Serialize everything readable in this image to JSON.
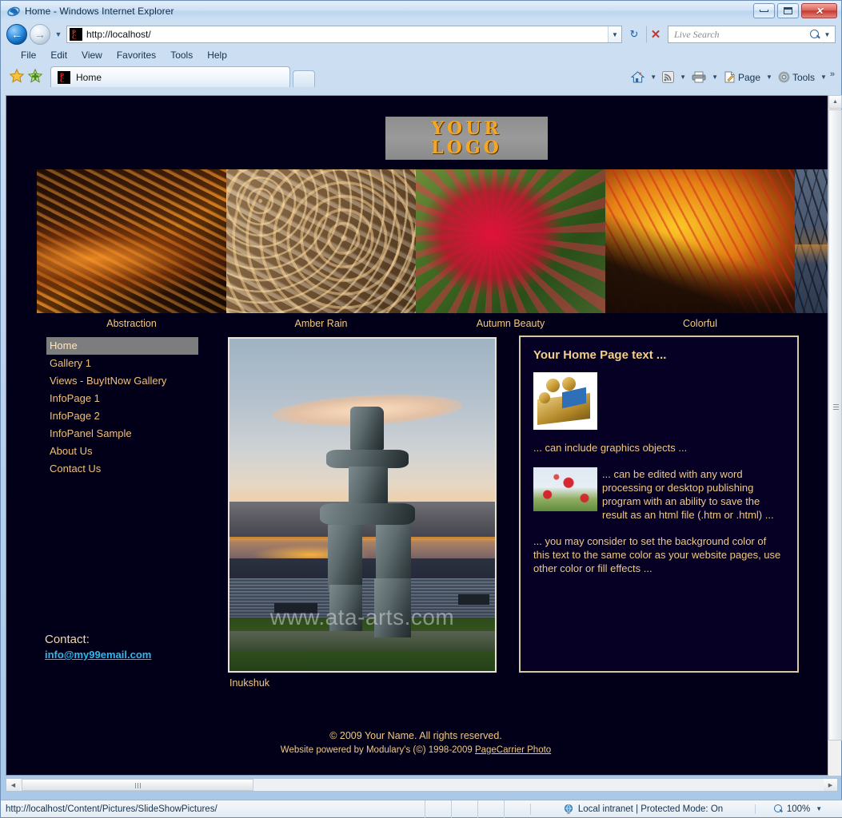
{
  "browser": {
    "window_title": "Home - Windows Internet Explorer",
    "controls": {
      "minimize": "Minimize",
      "maximize": "Maximize",
      "close": "Close"
    },
    "address": {
      "url": "http://localhost/",
      "refresh_label": "Refresh",
      "stop_label": "Stop"
    },
    "search": {
      "placeholder": "Live Search",
      "value": ""
    },
    "menus": [
      "File",
      "Edit",
      "View",
      "Favorites",
      "Tools",
      "Help"
    ],
    "tabs": [
      {
        "label": "Home",
        "active": true
      }
    ],
    "new_tab_label": "New Tab",
    "favorites_label": "Favorites Center",
    "add_favorites_label": "Add to Favorites",
    "command_bar": {
      "home": "Home",
      "feeds": "Feeds",
      "print": "Print",
      "page": "Page",
      "tools": "Tools",
      "overflow": "»"
    }
  },
  "status_bar": {
    "url": "http://localhost/Content/Pictures/SlideShowPictures/",
    "zone": "Local intranet | Protected Mode: On",
    "zoom": "100%"
  },
  "page": {
    "background_color": "#020018",
    "accent_text_color": "#f0c986",
    "panel_border_color": "#d9c9a0",
    "link_color": "#2fb8ec",
    "logo": {
      "line1": "YOUR",
      "line2": "LOGO"
    },
    "gallery": {
      "thumbnails": [
        {
          "caption": "Abstraction",
          "art": "t1"
        },
        {
          "caption": "Amber Rain",
          "art": "t2"
        },
        {
          "caption": "Autumn Beauty",
          "art": "t3"
        },
        {
          "caption": "Colorful",
          "art": "t4"
        },
        {
          "caption": "",
          "art": "t5"
        }
      ]
    },
    "nav": {
      "items": [
        {
          "label": "Home",
          "active": true
        },
        {
          "label": "Gallery  1",
          "active": false
        },
        {
          "label": "Views -  BuyItNow  Gallery",
          "active": false
        },
        {
          "label": "InfoPage  1",
          "active": false
        },
        {
          "label": "InfoPage  2",
          "active": false
        },
        {
          "label": "InfoPanel Sample",
          "active": false
        },
        {
          "label": "About Us",
          "active": false
        },
        {
          "label": "Contact Us",
          "active": false
        }
      ]
    },
    "contact": {
      "label": "Contact:",
      "email": "info@my99email.com"
    },
    "feature_photo": {
      "caption": "Inukshuk",
      "watermark": "www.ata-arts.com"
    },
    "panel": {
      "heading": "Your Home Page text ...",
      "caption1": "... can include graphics objects ...",
      "paragraph1": "... can be edited with any word processing or desktop publishing program  with an ability to save the result as an html file (.htm or .html)  ...",
      "paragraph2": "... you may consider to set the background color of this text to the same color as your website pages, use other color or fill effects  ..."
    },
    "footer": {
      "line1": "© 2009 Your Name. All rights reserved.",
      "line2_prefix": "Website powered by Modulary's (©) 1998-2009 ",
      "line2_link": "PageCarrier Photo"
    }
  }
}
